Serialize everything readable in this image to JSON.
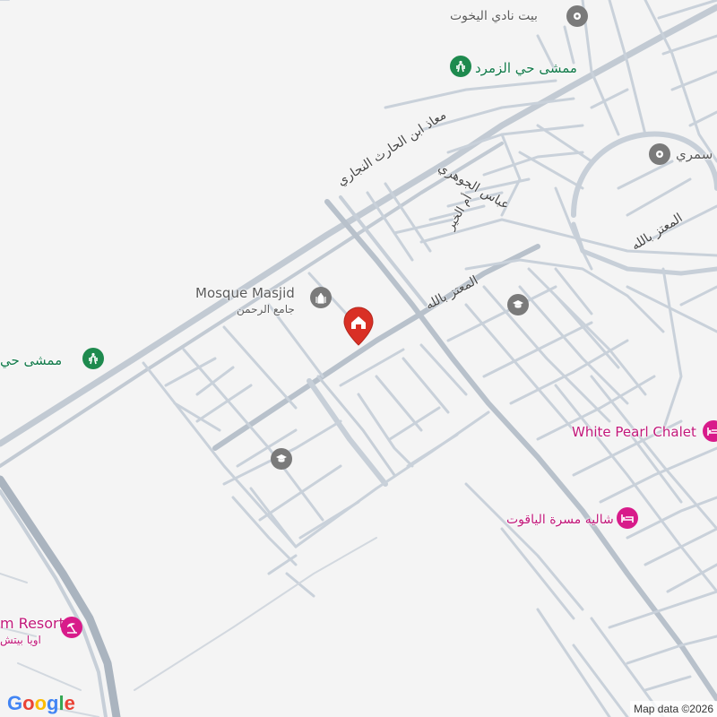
{
  "map": {
    "pois": [
      {
        "id": "yacht-club",
        "name": "بيت نادي اليخوت",
        "category": "gray"
      },
      {
        "id": "zumurrud-walk",
        "name": "ممشى حي الزمرد",
        "category": "green"
      },
      {
        "id": "samari",
        "name": "سمري",
        "category": "gray"
      },
      {
        "id": "mosque",
        "name": "Mosque Masjid",
        "subtitle": "جامع الرحمن",
        "category": "gray"
      },
      {
        "id": "walk-left",
        "name": "ممشى حي",
        "category": "green"
      },
      {
        "id": "school-1",
        "name": "",
        "category": "gray"
      },
      {
        "id": "school-2",
        "name": "",
        "category": "gray"
      },
      {
        "id": "white-pearl",
        "name": "White Pearl Chalet",
        "category": "pink"
      },
      {
        "id": "yaqoot",
        "name": "شاليه مسرة الياقوت",
        "category": "pink"
      },
      {
        "id": "resort",
        "name": "m Resort",
        "subtitle": "اويا بيتش",
        "category": "pink"
      }
    ],
    "streets": [
      {
        "id": "muadh",
        "name": "معاذ ابن الحارث النجاري"
      },
      {
        "id": "abbas",
        "name": "عباس الجوهري"
      },
      {
        "id": "umm-khair",
        "name": "أم الخير"
      },
      {
        "id": "mutaz-1",
        "name": "المعتز بالله"
      },
      {
        "id": "mutaz-2",
        "name": "المعتز بالله"
      }
    ],
    "colors": {
      "background": "#f4f4f4",
      "road": "#c7cfd8",
      "road_major": "#aab4bf",
      "poi_gray": "#7a7a7a",
      "poi_green": "#1e8a4e",
      "poi_pink": "#d81b8a",
      "marker": "#d93025"
    },
    "icons": {
      "place": "place-icon",
      "hiking": "hiking-icon",
      "school": "school-icon",
      "hotel": "hotel-icon",
      "resort": "beach-umbrella-icon",
      "home_marker": "home-marker-icon"
    }
  },
  "branding": {
    "logo": "Google",
    "attribution": "Map data ©2026"
  }
}
